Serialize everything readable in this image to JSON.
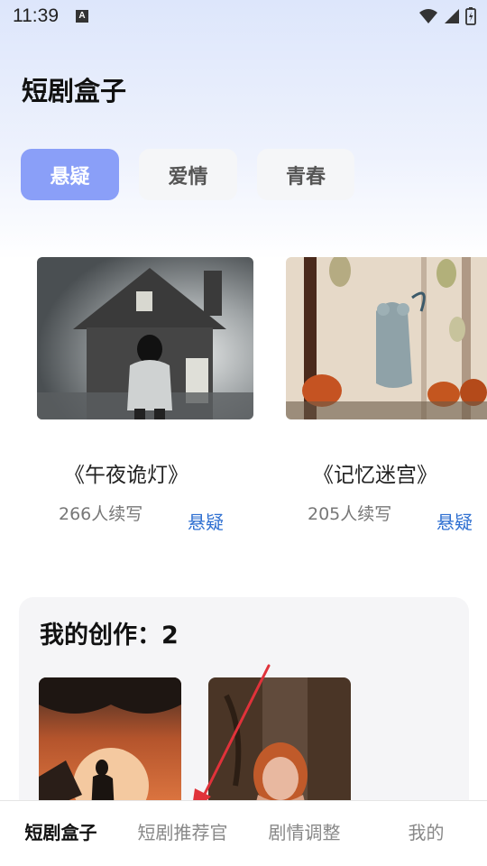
{
  "status_bar": {
    "time": "11:39",
    "notification_badge": "A"
  },
  "header": {
    "title": "短剧盒子"
  },
  "tabs": [
    {
      "label": "悬疑",
      "active": true
    },
    {
      "label": "爱情",
      "active": false
    },
    {
      "label": "青春",
      "active": false
    }
  ],
  "dramas": [
    {
      "title": "《午夜诡灯》",
      "count": "266人续写",
      "tag": "悬疑",
      "cover": "haunted-house-boy"
    },
    {
      "title": "《记忆迷宫》",
      "count": "205人续写",
      "tag": "悬疑",
      "cover": "forest-ghosts-mouse"
    }
  ],
  "creations": {
    "title": "我的创作：2",
    "thumbs": [
      "sunset-girl-silhouette",
      "crying-girl-forest"
    ]
  },
  "bottom_nav": [
    {
      "label": "短剧盒子",
      "active": true
    },
    {
      "label": "短剧推荐官",
      "active": false
    },
    {
      "label": "剧情调整",
      "active": false
    },
    {
      "label": "我的",
      "active": false
    }
  ],
  "colors": {
    "accent": "#8a9ff8",
    "tag_blue": "#2e6fd1",
    "annotation_arrow": "#e0323a"
  }
}
